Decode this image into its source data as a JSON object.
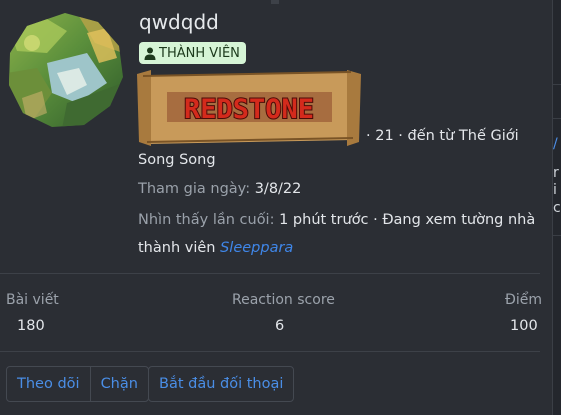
{
  "profile": {
    "username": "qwdqdd",
    "role_badge": "THÀNH VIÊN",
    "banner_text": "REDSTONE",
    "location_line_1": "· 21 · đến từ Thế Giới",
    "location_line_2": "Song Song",
    "joined_label": "Tham gia ngày:",
    "joined_value": "3/8/22",
    "last_seen_label": "Nhìn thấy lần cuối:",
    "last_seen_value": "1 phút trước · Đang xem tường nhà",
    "last_seen_value_2": "thành viên",
    "last_seen_link": "Sleeppara"
  },
  "stats": [
    {
      "label": "Bài viết",
      "value": "180"
    },
    {
      "label": "Reaction score",
      "value": "6"
    },
    {
      "label": "Điểm",
      "value": "100"
    }
  ],
  "actions": {
    "follow": "Theo dõi",
    "block": "Chặn",
    "start_conversation": "Bắt đầu đối thoại"
  },
  "icons": {
    "badge_icon": "user-icon"
  },
  "colors": {
    "card_bg": "#2b2e34",
    "link": "#4a8ee6",
    "badge_bg": "#d6f5d6",
    "banner_red": "#c8201a"
  }
}
